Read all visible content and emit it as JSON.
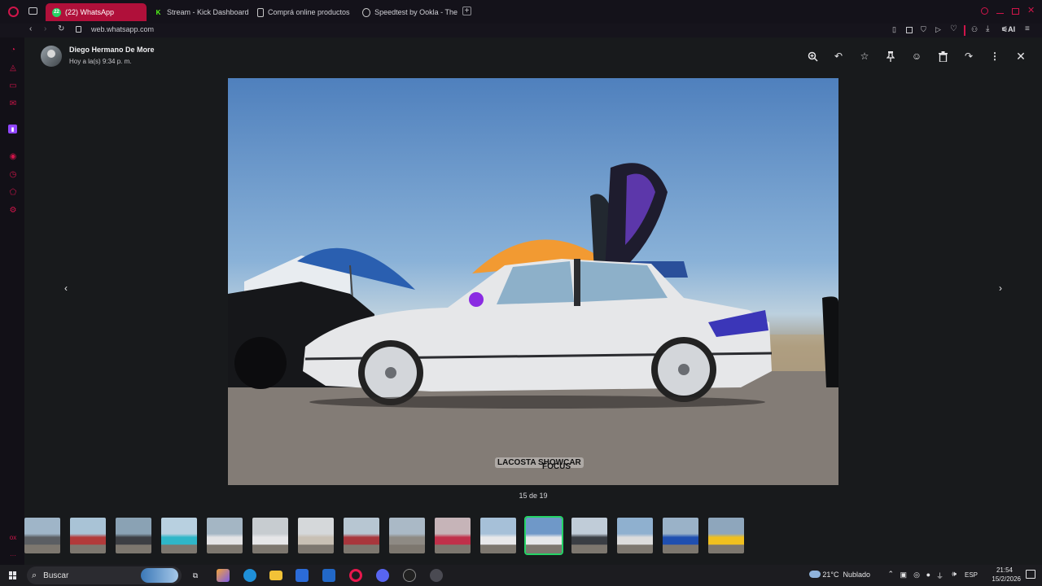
{
  "browser": {
    "tabs": [
      {
        "label": "(22) WhatsApp",
        "badge": "22",
        "icon": "whatsapp-icon",
        "color": "#25d366",
        "active": true
      },
      {
        "label": "Stream - Kick Dashboard",
        "icon": "kick-icon",
        "color": "#53fc18"
      },
      {
        "label": "Comprá online productos",
        "icon": "document-icon",
        "color": "#c8c8c8"
      },
      {
        "label": "Speedtest by Ookla - The",
        "icon": "speedtest-icon",
        "color": "#c8c8c8"
      }
    ],
    "url": "web.whatsapp.com",
    "ai_label": "AI",
    "accent": "#b0103a"
  },
  "viewer": {
    "sender_name": "Diego Hermano De More",
    "sender_time": "Hoy a la(s) 9:34 p. m.",
    "counter": "15 de 19",
    "photo_overlay_logo": "LACOSTA SHOWCAR",
    "photo_overlay_logo2": "FOCUS",
    "toolbar": [
      "zoom-in-icon",
      "reply-icon",
      "star-icon",
      "pin-icon",
      "emoji-icon",
      "delete-icon",
      "forward-icon",
      "more-icon",
      "close-icon"
    ],
    "thumbnails_count": 16,
    "selected_thumbnail": 11
  },
  "taskbar": {
    "search_label": "Buscar",
    "weather": "21°C  Nublado",
    "language": "ESP",
    "time": "21:54",
    "date": "15/2/2026"
  }
}
